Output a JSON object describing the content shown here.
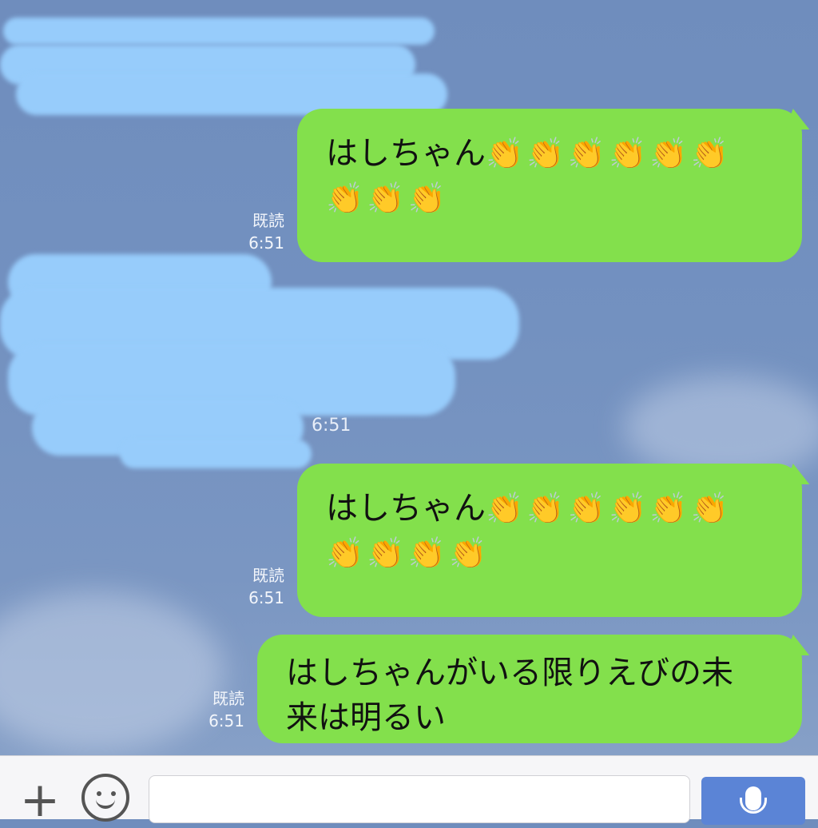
{
  "messages": [
    {
      "text": "はしちゃん",
      "clap_count": 9,
      "read_label": "既読",
      "time": "6:51"
    },
    {
      "text": "はしちゃん",
      "clap_count": 10,
      "read_label": "既読",
      "time": "6:51"
    },
    {
      "text_line1": "はしちゃんがいる限りえびの未",
      "text_line2": "来は明るい",
      "read_label": "既読",
      "time": "6:51"
    }
  ],
  "incoming": {
    "time": "6:51"
  },
  "icons": {
    "clap": "👏",
    "plus": "+",
    "emoji": "smile-face-icon",
    "mic": "mic-icon"
  },
  "colors": {
    "sent_bubble": "#83e04c",
    "send_button": "#5b84d6",
    "redaction": "#97ccfb"
  }
}
